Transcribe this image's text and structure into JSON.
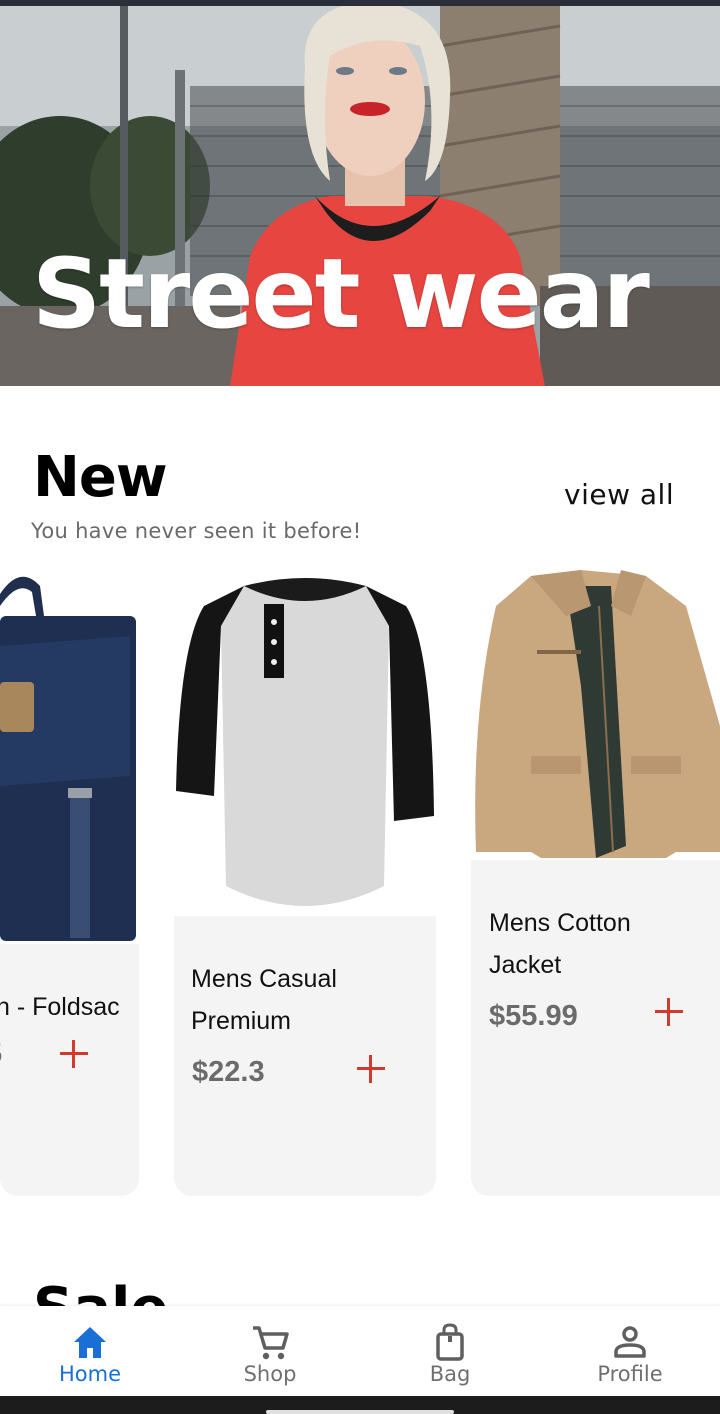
{
  "hero": {
    "title": "Street wear"
  },
  "section": {
    "title": "New",
    "subtitle": "You have never seen it before!",
    "view_all": "view all",
    "next_section_peek": "Sale"
  },
  "products": [
    {
      "name_line1": "n - Foldsac",
      "name_line2": "",
      "price": "5"
    },
    {
      "name_line1": "Mens Casual",
      "name_line2": "Premium",
      "price": "$22.3"
    },
    {
      "name_line1": "Mens Cotton",
      "name_line2": "Jacket",
      "price": "$55.99"
    }
  ],
  "nav": {
    "items": [
      {
        "label": "Home",
        "icon": "home-icon",
        "active": true
      },
      {
        "label": "Shop",
        "icon": "cart-icon",
        "active": false
      },
      {
        "label": "Bag",
        "icon": "bag-icon",
        "active": false
      },
      {
        "label": "Profile",
        "icon": "person-icon",
        "active": false
      }
    ]
  },
  "colors": {
    "accent": "#1a6fd6",
    "add_button": "#d23a2c",
    "card_bg": "#f4f4f4",
    "price": "#6b6b6b"
  }
}
